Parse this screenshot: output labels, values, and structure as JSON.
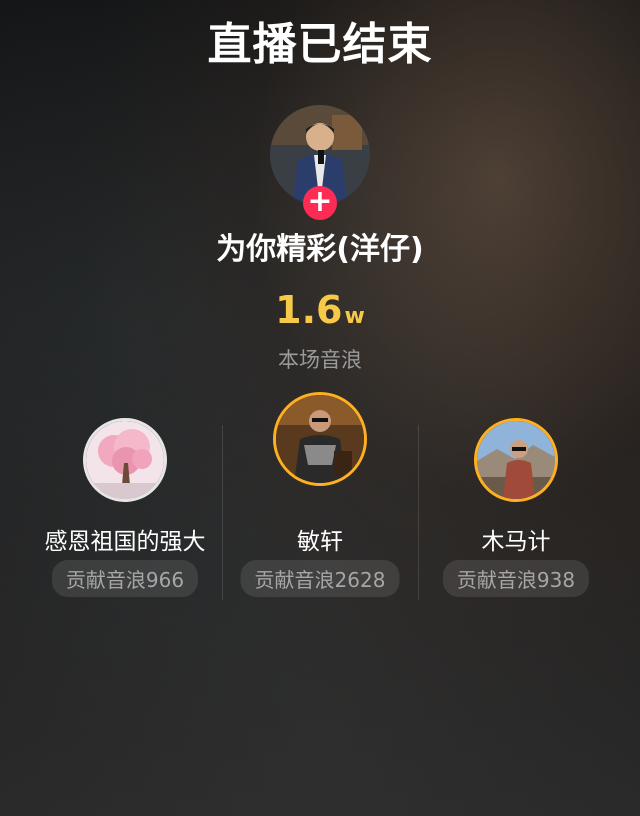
{
  "header": {
    "title": "直播已结束"
  },
  "host": {
    "name": "为你精彩(洋仔)",
    "follow_label": "+"
  },
  "summary": {
    "value": "1.6",
    "unit": "w",
    "label": "本场音浪"
  },
  "contributors": [
    {
      "name": "感恩祖国的强大",
      "contribution": "贡献音浪966"
    },
    {
      "name": "敏轩",
      "contribution": "贡献音浪2628"
    },
    {
      "name": "木马计",
      "contribution": "贡献音浪938"
    }
  ],
  "colors": {
    "accent_gold": "#f7c948",
    "follow_red": "#fe2c55",
    "ring_orange": "#ffb020"
  }
}
